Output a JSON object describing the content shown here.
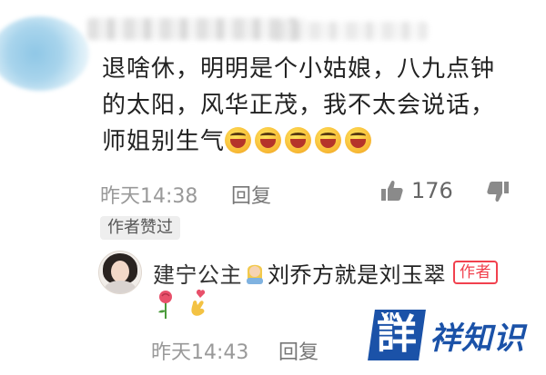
{
  "comment": {
    "lines": [
      "退啥休，明明是个小姑娘，八九点钟",
      "的太阳，风华正茂，我不太会说话，",
      "师姐别生气"
    ],
    "emoji_icon": "laughing-emoji-icon",
    "time": "昨天14:38",
    "reply_label": "回复",
    "like_count": "176",
    "author_liked": "作者赞过"
  },
  "reply": {
    "author": "建宁公主",
    "person_icon": "woman-emoji-icon",
    "text": "刘乔方就是刘玉翠",
    "author_tag": "作者",
    "stickers": [
      "rose-icon",
      "finger-heart-icon"
    ],
    "time": "昨天14:43",
    "reply_label": "回复"
  },
  "watermark": {
    "mark": "詳",
    "mark_small": "YM",
    "text": "祥知识"
  },
  "colors": {
    "author_tag": "#f1414e",
    "logo_blue": "#1b52a8",
    "meta_gray": "#999999"
  }
}
